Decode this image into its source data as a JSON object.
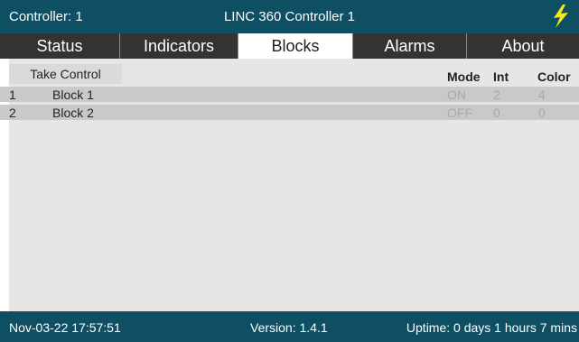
{
  "header": {
    "controller_label": "Controller: 1",
    "title": "LINC 360 Controller 1",
    "icon": "lightning-bolt",
    "accent_color": "#f4ea1b",
    "bar_color": "#0f4f63"
  },
  "tabs": [
    {
      "label": "Status",
      "active": false
    },
    {
      "label": "Indicators",
      "active": false
    },
    {
      "label": "Blocks",
      "active": true
    },
    {
      "label": "Alarms",
      "active": false
    },
    {
      "label": "About",
      "active": false
    }
  ],
  "blocks": {
    "take_control_label": "Take Control",
    "columns": {
      "mode": "Mode",
      "int": "Int",
      "color": "Color"
    },
    "rows": [
      {
        "num": "1",
        "name": "Block 1",
        "mode": "ON",
        "int": "2",
        "color": "4"
      },
      {
        "num": "2",
        "name": "Block 2",
        "mode": "OFF",
        "int": "0",
        "color": "0"
      }
    ]
  },
  "footer": {
    "datetime": "Nov-03-22 17:57:51",
    "version": "Version: 1.4.1",
    "uptime": "Uptime: 0 days 1 hours 7 mins"
  }
}
